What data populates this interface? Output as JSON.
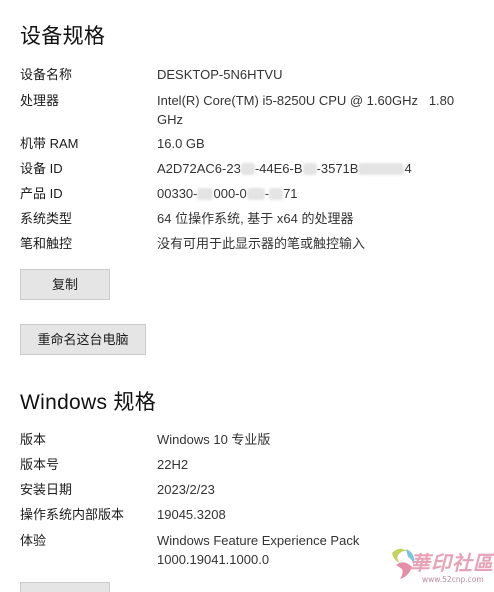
{
  "device_specs": {
    "title": "设备规格",
    "rows": [
      {
        "label": "设备名称",
        "value": "DESKTOP-5N6HTVU"
      },
      {
        "label": "处理器",
        "value": "Intel(R) Core(TM) i5-8250U CPU @ 1.60GHz   1.80 GHz"
      },
      {
        "label": "机带 RAM",
        "value": "16.0 GB"
      },
      {
        "label": "设备 ID",
        "value_parts": [
          "A2D72AC6-23",
          "-44E6-B",
          "-3571B",
          "4"
        ]
      },
      {
        "label": "产品 ID",
        "value_parts": [
          "00330-",
          "000-0",
          "-",
          "71"
        ]
      },
      {
        "label": "系统类型",
        "value": "64 位操作系统, 基于 x64 的处理器"
      },
      {
        "label": "笔和触控",
        "value": "没有可用于此显示器的笔或触控输入"
      }
    ],
    "copy_button": "复制",
    "rename_button": "重命名这台电脑"
  },
  "windows_specs": {
    "title": "Windows 规格",
    "rows": [
      {
        "label": "版本",
        "value": "Windows 10 专业版"
      },
      {
        "label": "版本号",
        "value": "22H2"
      },
      {
        "label": "安装日期",
        "value": "2023/2/23"
      },
      {
        "label": "操作系统内部版本",
        "value": "19045.3208"
      },
      {
        "label": "体验",
        "value": "Windows Feature Experience Pack 1000.19041.1000.0"
      }
    ]
  },
  "watermark": {
    "text": "華印社區",
    "url": "www.52cnp.com"
  },
  "colors": {
    "button_bg": "#e5e5e5",
    "text": "#1b1b1b",
    "watermark": "#e8a2b8"
  }
}
